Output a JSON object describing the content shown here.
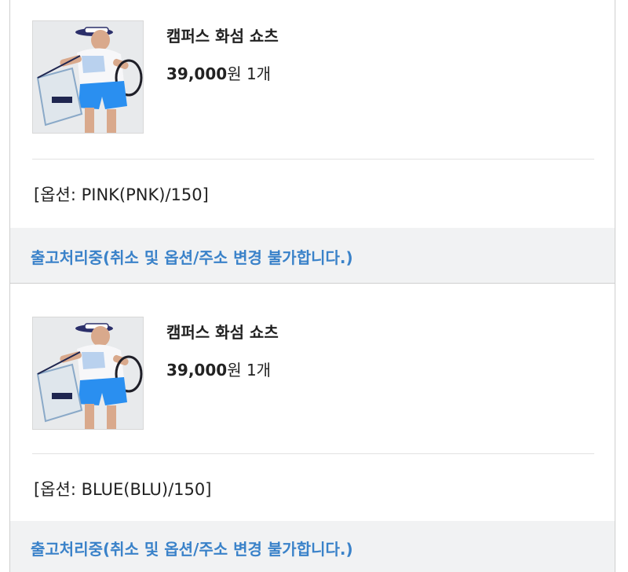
{
  "orders": [
    {
      "thumbnail_icon": "product-photo",
      "product_name": "캠퍼스 화섬 쇼츠",
      "price": "39,000",
      "currency": "원",
      "quantity": "1개",
      "option": "[옵션: PINK(PNK)/150]",
      "status": "출고처리중(취소 및 옵션/주소 변경 불가합니다.)"
    },
    {
      "thumbnail_icon": "product-photo",
      "product_name": "캠퍼스 화섬 쇼츠",
      "price": "39,000",
      "currency": "원",
      "quantity": "1개",
      "option": "[옵션: BLUE(BLU)/150]",
      "status": "출고처리중(취소 및 옵션/주소 변경 불가합니다.)"
    }
  ],
  "colors": {
    "status_text": "#3a82c9",
    "status_bg": "#f1f2f3",
    "border": "#cfcfcf"
  }
}
